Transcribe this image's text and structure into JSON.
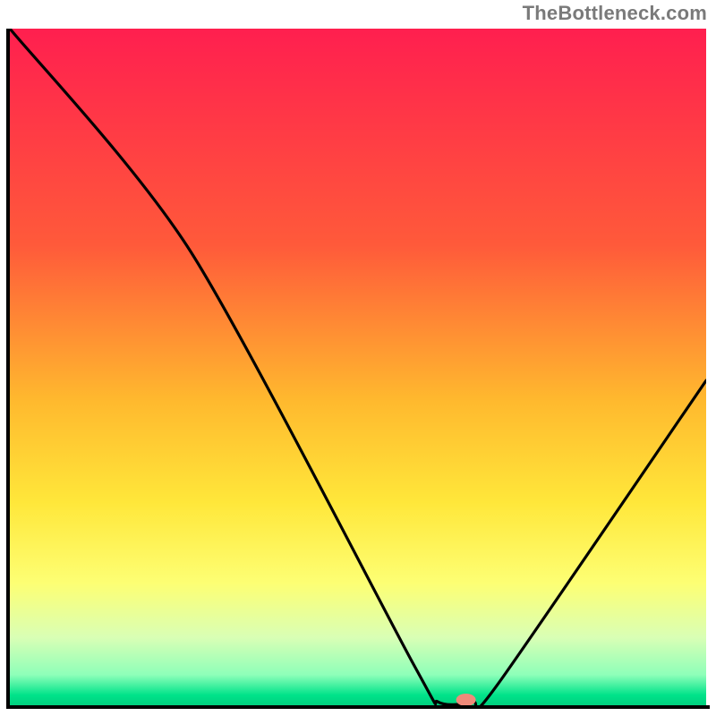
{
  "watermark": "TheBottleneck.com",
  "chart_data": {
    "type": "line",
    "title": "",
    "xlabel": "",
    "ylabel": "",
    "xlim": [
      0,
      100
    ],
    "ylim": [
      0,
      100
    ],
    "grid": false,
    "legend": false,
    "gradient_stops": [
      {
        "offset": 0.0,
        "color": "#ff1f4f"
      },
      {
        "offset": 0.32,
        "color": "#ff5a3a"
      },
      {
        "offset": 0.55,
        "color": "#ffb92e"
      },
      {
        "offset": 0.7,
        "color": "#ffe73a"
      },
      {
        "offset": 0.82,
        "color": "#fdff74"
      },
      {
        "offset": 0.9,
        "color": "#d9ffb5"
      },
      {
        "offset": 0.955,
        "color": "#8effb9"
      },
      {
        "offset": 0.985,
        "color": "#00e38a"
      },
      {
        "offset": 1.0,
        "color": "#00d07f"
      }
    ],
    "curve_points": [
      {
        "x": 0.0,
        "y": 100.0
      },
      {
        "x": 26.0,
        "y": 67.0
      },
      {
        "x": 58.0,
        "y": 6.0
      },
      {
        "x": 61.5,
        "y": 0.5
      },
      {
        "x": 66.5,
        "y": 0.5
      },
      {
        "x": 70.0,
        "y": 3.0
      },
      {
        "x": 100.0,
        "y": 48.0
      }
    ],
    "marker": {
      "x": 65.5,
      "y": 0.8,
      "color": "#f08a7a"
    }
  }
}
